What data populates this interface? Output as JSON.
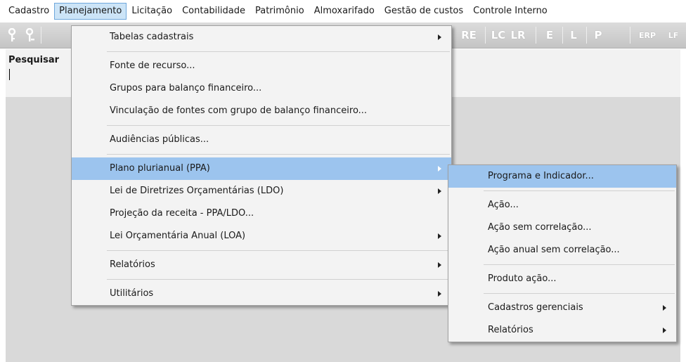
{
  "menubar": {
    "items": [
      "Cadastro",
      "Planejamento",
      "Licitação",
      "Contabilidade",
      "Patrimônio",
      "Almoxarifado",
      "Gestão de custos",
      "Controle Interno"
    ]
  },
  "toolbar": {
    "visible_labels": [
      "RE",
      "LC",
      "LR",
      "E",
      "L",
      "P",
      "ERP",
      "LF"
    ]
  },
  "search": {
    "label": "Pesquisar"
  },
  "planejamento_menu": {
    "items": [
      {
        "label": "Tabelas cadastrais",
        "submenu": true
      },
      {
        "label": "Fonte de recurso...",
        "submenu": false
      },
      {
        "label": "Grupos para balanço financeiro...",
        "submenu": false
      },
      {
        "label": "Vinculação de fontes com grupo de balanço financeiro...",
        "submenu": false
      },
      {
        "label": "Audiências públicas...",
        "submenu": false
      },
      {
        "label": "Plano plurianual (PPA)",
        "submenu": true,
        "highlighted": true
      },
      {
        "label": "Lei de Diretrizes Orçamentárias (LDO)",
        "submenu": true
      },
      {
        "label": "Projeção da receita - PPA/LDO...",
        "submenu": false
      },
      {
        "label": "Lei Orçamentária Anual (LOA)",
        "submenu": true
      },
      {
        "label": "Relatórios",
        "submenu": true
      },
      {
        "label": "Utilitários",
        "submenu": true
      }
    ]
  },
  "ppa_submenu": {
    "items": [
      {
        "label": "Programa e Indicador...",
        "submenu": false,
        "highlighted": true
      },
      {
        "label": "Ação...",
        "submenu": false
      },
      {
        "label": "Ação sem correlação...",
        "submenu": false
      },
      {
        "label": "Ação anual sem correlação...",
        "submenu": false
      },
      {
        "label": "Produto ação...",
        "submenu": false
      },
      {
        "label": "Cadastros gerenciais",
        "submenu": true
      },
      {
        "label": "Relatórios",
        "submenu": true
      }
    ]
  },
  "colors": {
    "highlight": "#9cc4ee",
    "active_menubar": "#cce4f7",
    "toolbar": "#c8c8c8"
  }
}
